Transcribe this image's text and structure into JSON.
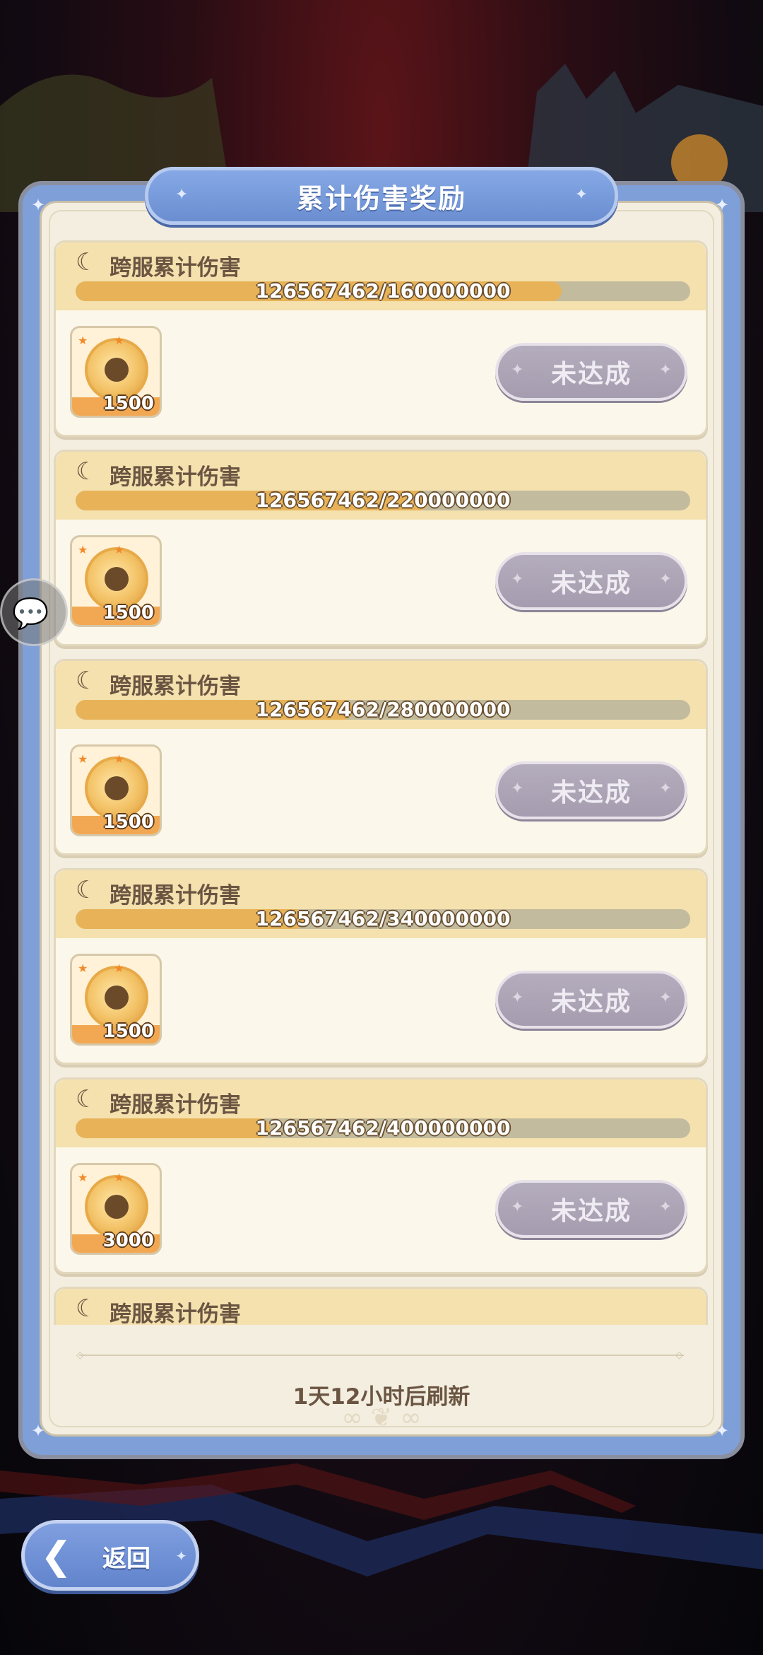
{
  "panel": {
    "title": "累计伤害奖励",
    "refresh_text": "1天12小时后刷新"
  },
  "rewards": [
    {
      "label": "跨服累计伤害",
      "progress_text": "126567462/160000000",
      "current": 126567462,
      "target": 160000000,
      "reward_count": "1500",
      "status": "未达成"
    },
    {
      "label": "跨服累计伤害",
      "progress_text": "126567462/220000000",
      "current": 126567462,
      "target": 220000000,
      "reward_count": "1500",
      "status": "未达成"
    },
    {
      "label": "跨服累计伤害",
      "progress_text": "126567462/280000000",
      "current": 126567462,
      "target": 280000000,
      "reward_count": "1500",
      "status": "未达成"
    },
    {
      "label": "跨服累计伤害",
      "progress_text": "126567462/340000000",
      "current": 126567462,
      "target": 340000000,
      "reward_count": "1500",
      "status": "未达成"
    },
    {
      "label": "跨服累计伤害",
      "progress_text": "126567462/400000000",
      "current": 126567462,
      "target": 400000000,
      "reward_count": "3000",
      "status": "未达成"
    },
    {
      "label": "跨服累计伤害"
    }
  ],
  "back_button": {
    "label": "返回"
  },
  "icons": {
    "chat": "chat-bubble-icon",
    "back": "back-arrow-icon",
    "moon": "crescent-moon-icon",
    "coin": "coin-icon"
  },
  "colors": {
    "panel_blue": "#7f9fd8",
    "progress_fill": "#e8b358",
    "button_disabled": "#a59daf"
  }
}
